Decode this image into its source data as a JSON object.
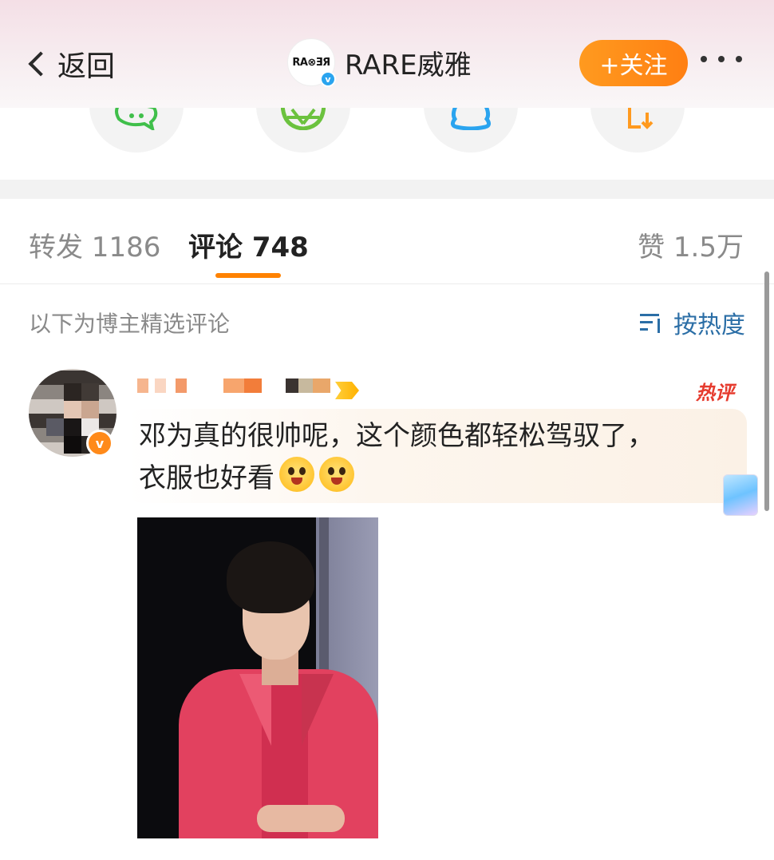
{
  "header": {
    "back_label": "返回",
    "account_logo": "RA⊗ƎЯ",
    "verified_mark": "v",
    "account_name": "RARE威雅",
    "follow_label": "+关注"
  },
  "share_icons": [
    "wechat-icon",
    "moments-icon",
    "qq-icon",
    "save-icon"
  ],
  "tabs": {
    "repost": "转发 1186",
    "comments": "评论 748",
    "likes": "赞 1.5万"
  },
  "section": {
    "label": "以下为博主精选评论",
    "sort_label": "按热度"
  },
  "comment": {
    "verified_mark": "v",
    "hot_tag": "热评",
    "text_line1": "邓为真的很帅呢，这个颜色都轻松驾驭了，",
    "text_line2": "衣服也好看",
    "emoji": "smiley-heart-emoji"
  },
  "colors": {
    "accent": "#ff8200",
    "link": "#2b6ea6",
    "hot": "#e63b2e"
  }
}
